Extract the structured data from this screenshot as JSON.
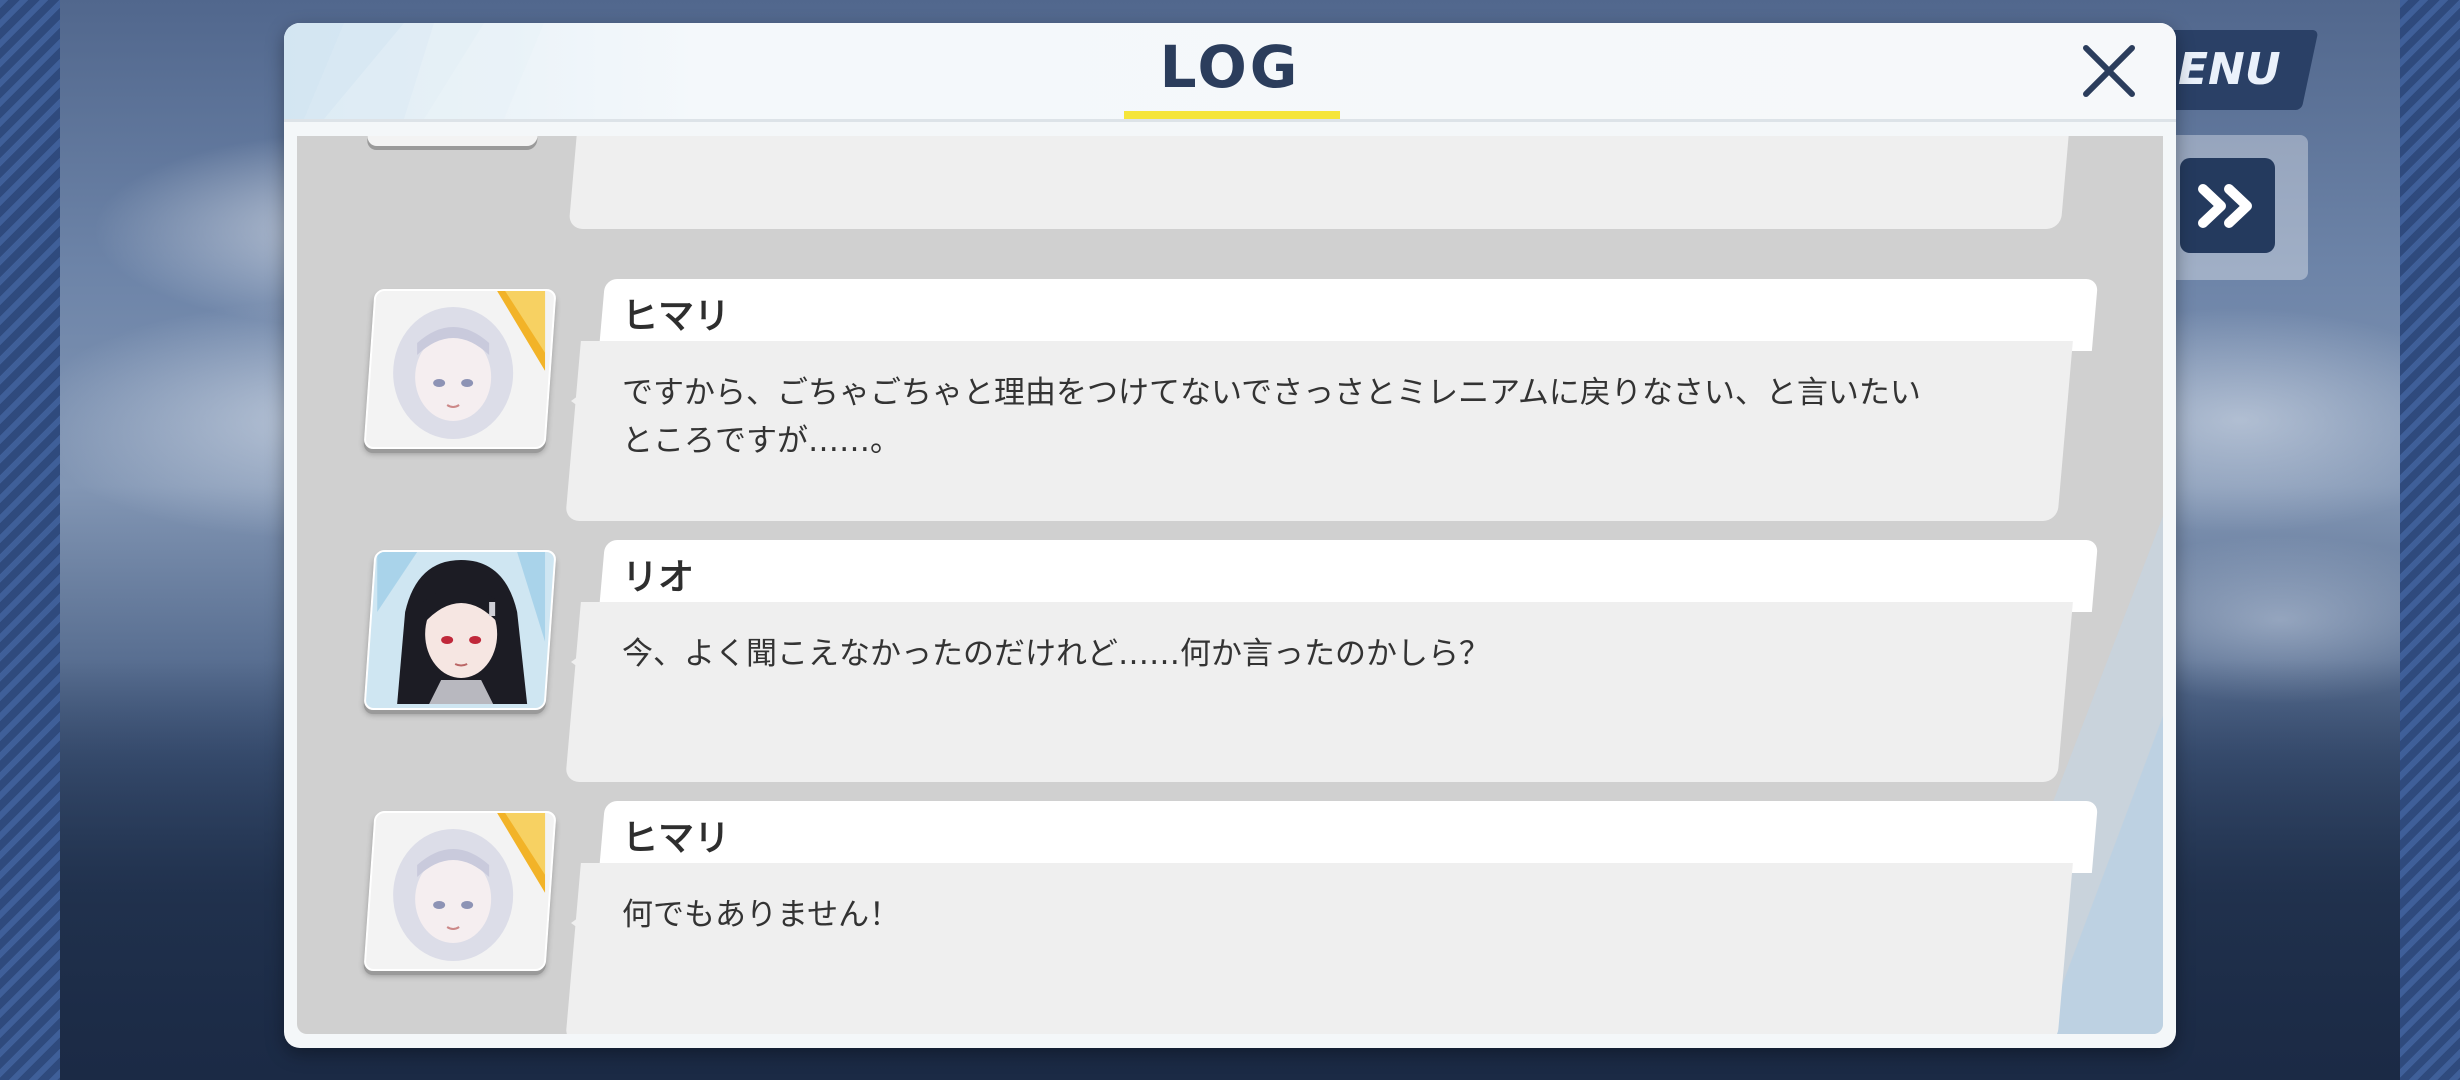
{
  "background": {
    "menu_label": "ENU",
    "skip_icon": "double-chevron-right-icon"
  },
  "dialog": {
    "title": "LOG",
    "close_icon": "close-icon",
    "accent_color": "#f5e53a",
    "title_color": "#2b3d5c"
  },
  "log_entries": [
    {
      "speaker": "ヒマリ",
      "avatar": "himari-portrait",
      "lines": [
        "ですから、ごちゃごちゃと理由をつけてないでさっさとミレニアムに戻りなさい、と言いたい",
        "ところですが……。"
      ]
    },
    {
      "speaker": "リオ",
      "avatar": "rio-portrait",
      "lines": [
        "今、よく聞こえなかったのだけれど……何か言ったのかしら？"
      ]
    },
    {
      "speaker": "ヒマリ",
      "avatar": "himari-portrait",
      "lines": [
        "何でもありません！"
      ]
    }
  ]
}
